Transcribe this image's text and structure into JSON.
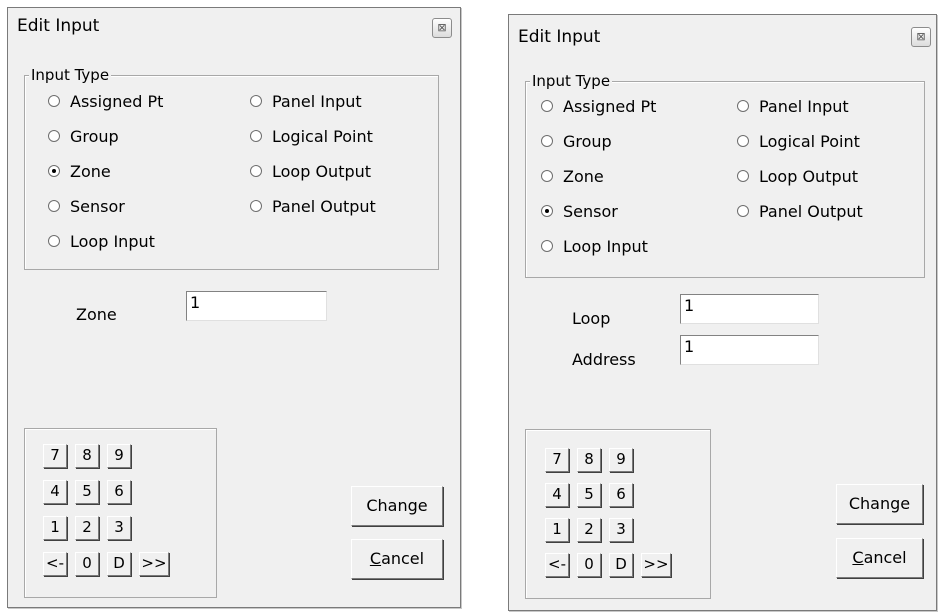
{
  "dialogs": [
    {
      "title": "Edit Input",
      "close_glyph": "⊠",
      "input_type_group": {
        "label": "Input Type",
        "options": [
          {
            "label": "Assigned Pt",
            "checked": false
          },
          {
            "label": "Group",
            "checked": false
          },
          {
            "label": "Zone",
            "checked": true
          },
          {
            "label": "Sensor",
            "checked": false
          },
          {
            "label": "Loop Input",
            "checked": false
          },
          {
            "label": "Panel Input",
            "checked": false
          },
          {
            "label": "Logical Point",
            "checked": false
          },
          {
            "label": "Loop Output",
            "checked": false
          },
          {
            "label": "Panel Output",
            "checked": false
          }
        ]
      },
      "fields": [
        {
          "label": "Zone",
          "value": "1"
        }
      ],
      "keypad": [
        "7",
        "8",
        "9",
        "4",
        "5",
        "6",
        "1",
        "2",
        "3",
        "<-",
        "0",
        "D",
        ">>"
      ],
      "change_label": "Change",
      "cancel_label": "Cancel",
      "cancel_accel": "C",
      "cancel_rest": "ancel"
    },
    {
      "title": "Edit Input",
      "close_glyph": "⊠",
      "input_type_group": {
        "label": "Input Type",
        "options": [
          {
            "label": "Assigned Pt",
            "checked": false
          },
          {
            "label": "Group",
            "checked": false
          },
          {
            "label": "Zone",
            "checked": false
          },
          {
            "label": "Sensor",
            "checked": true
          },
          {
            "label": "Loop Input",
            "checked": false
          },
          {
            "label": "Panel Input",
            "checked": false
          },
          {
            "label": "Logical Point",
            "checked": false
          },
          {
            "label": "Loop Output",
            "checked": false
          },
          {
            "label": "Panel Output",
            "checked": false
          }
        ]
      },
      "fields": [
        {
          "label": "Loop",
          "value": "1"
        },
        {
          "label": "Address",
          "value": "1"
        }
      ],
      "keypad": [
        "7",
        "8",
        "9",
        "4",
        "5",
        "6",
        "1",
        "2",
        "3",
        "<-",
        "0",
        "D",
        ">>"
      ],
      "change_label": "Change",
      "cancel_label": "Cancel",
      "cancel_accel": "C",
      "cancel_rest": "ancel"
    }
  ]
}
